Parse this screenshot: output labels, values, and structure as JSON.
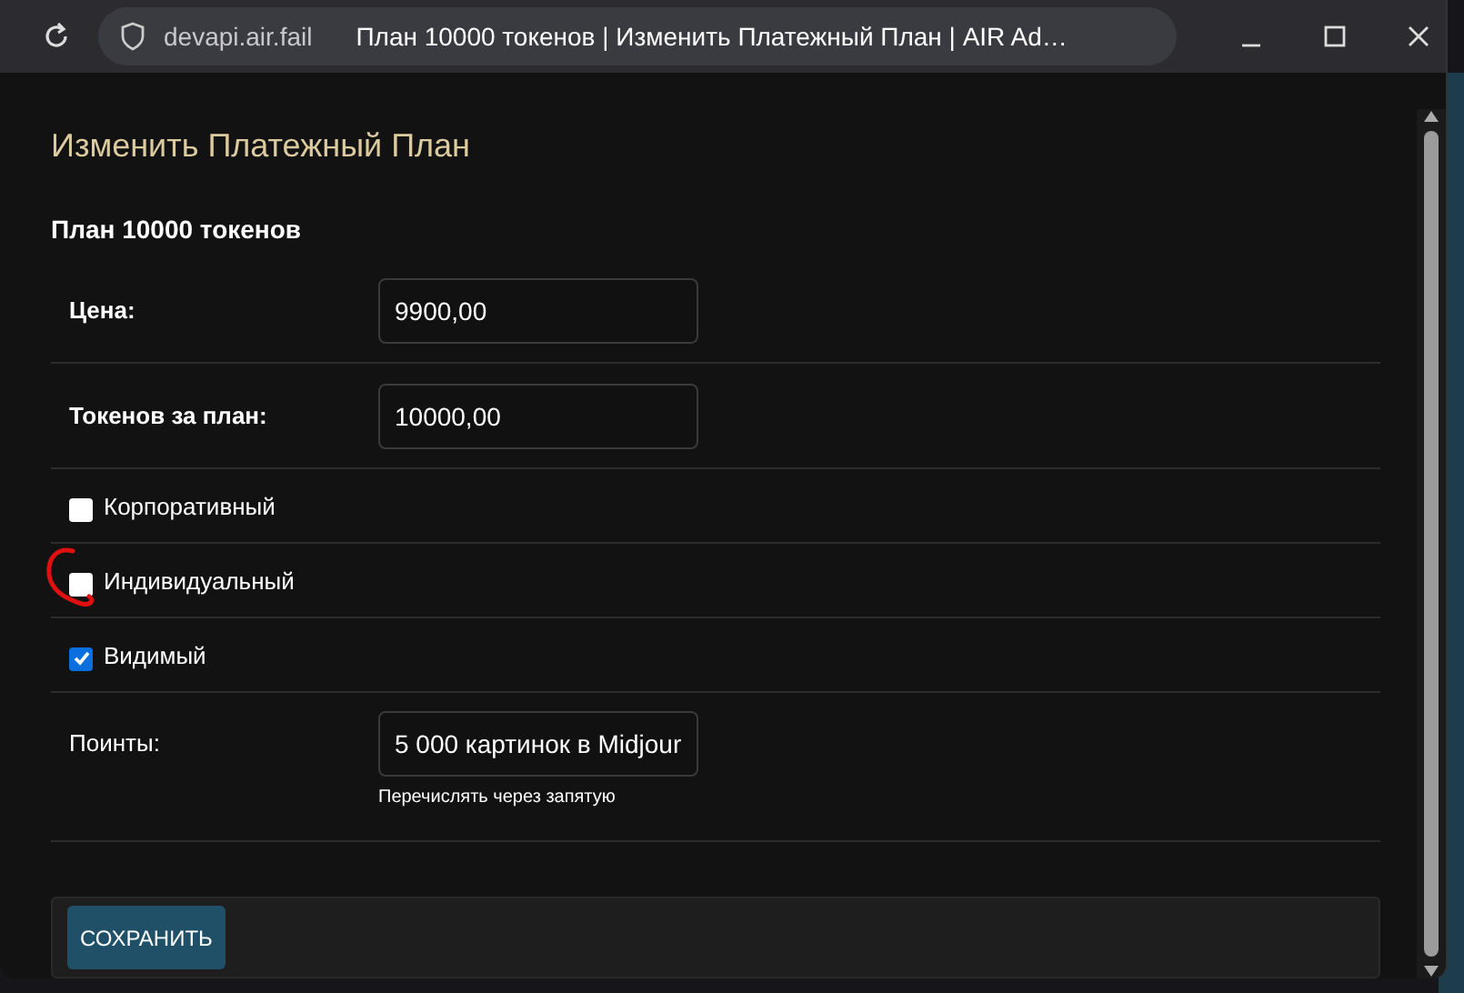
{
  "window": {
    "url": "devapi.air.fail",
    "title": "План 10000 токенов | Изменить Платежный План | AIR Ad…"
  },
  "form": {
    "title": "Изменить Платежный План",
    "heading": "План 10000 токенов",
    "fields": [
      {
        "kind": "input",
        "label": "Цена:",
        "bold": true,
        "value": "9900,00"
      },
      {
        "kind": "input",
        "label": "Токенов за план:",
        "bold": true,
        "value": "10000,00"
      },
      {
        "kind": "checkbox",
        "label": "Корпоративный",
        "checked": false
      },
      {
        "kind": "checkbox",
        "label": "Индивидуальный",
        "checked": false
      },
      {
        "kind": "checkbox",
        "label": "Видимый",
        "checked": true
      },
      {
        "kind": "input",
        "label": "Поинты:",
        "bold": false,
        "value": "5 000 картинок в Midjour",
        "hint": "Перечислять через запятую"
      }
    ],
    "save_button": "СОХРАНИТЬ"
  }
}
